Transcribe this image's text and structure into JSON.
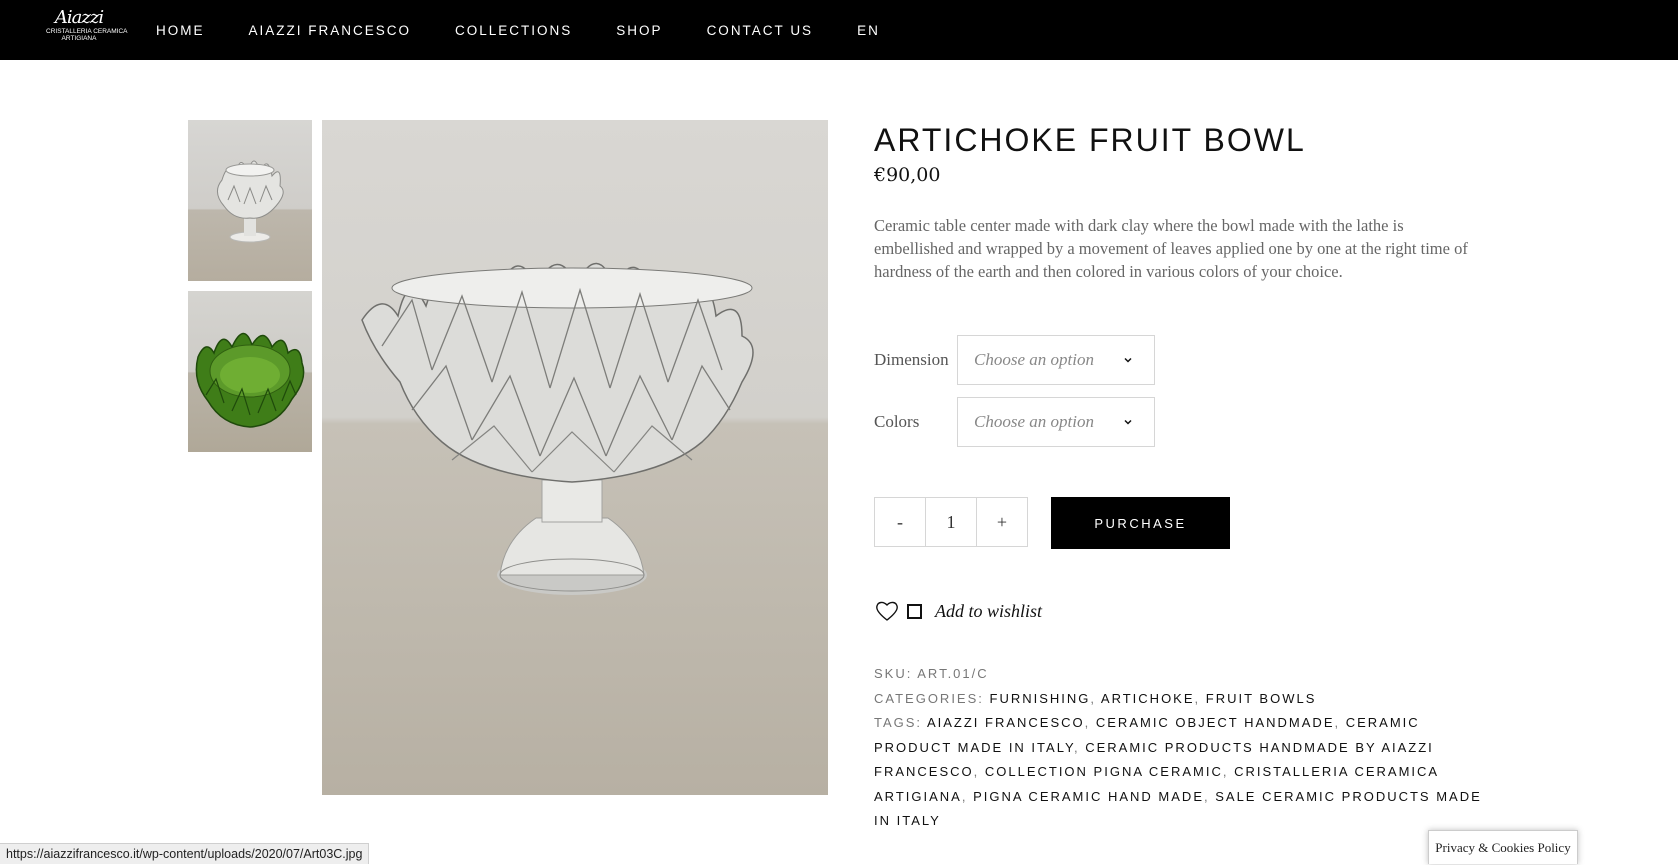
{
  "brand": {
    "logo_script": "Aiazzi",
    "logo_line1": "CRISTALLERIA CERAMICA",
    "logo_line2": "ARTIGIANA"
  },
  "nav": {
    "items": [
      "HOME",
      "AIAZZI FRANCESCO",
      "COLLECTIONS",
      "SHOP",
      "CONTACT US",
      "EN"
    ]
  },
  "product": {
    "title": "ARTICHOKE FRUIT BOWL",
    "price": "€90,00",
    "description": "Ceramic table center made with dark clay where the bowl made with the lathe is embellished and wrapped by a movement of leaves applied one by one at the right time of hardness of the earth and then colored in various colors of your choice.",
    "variations": [
      {
        "label": "Dimension",
        "placeholder": "Choose an option"
      },
      {
        "label": "Colors",
        "placeholder": "Choose an option"
      }
    ],
    "qty": {
      "minus": "-",
      "value": "1",
      "plus": "+"
    },
    "purchase_label": "PURCHASE",
    "wishlist_label": "Add to wishlist",
    "meta": {
      "sku_label": "SKU:",
      "sku": "ART.01/C",
      "categories_label": "CATEGORIES:",
      "categories": [
        "FURNISHING",
        "ARTICHOKE",
        "FRUIT BOWLS"
      ],
      "tags_label": "TAGS:",
      "tags": [
        "AIAZZI FRANCESCO",
        "CERAMIC OBJECT HANDMADE",
        "CERAMIC PRODUCT MADE IN ITALY",
        "CERAMIC PRODUCTS HANDMADE BY AIAZZI FRANCESCO",
        "COLLECTION PIGNA CERAMIC",
        "CRISTALLERIA CERAMICA ARTIGIANA",
        "PIGNA CERAMIC HAND MADE",
        "SALE CERAMIC PRODUCTS MADE IN ITALY"
      ]
    }
  },
  "gallery": {
    "thumbnails": [
      "white-artichoke-bowl",
      "green-artichoke-bowl"
    ],
    "main": "white-artichoke-bowl"
  },
  "statusbar": {
    "url": "https://aiazzifrancesco.it/wp-content/uploads/2020/07/Art03C.jpg"
  },
  "privacy": {
    "label": "Privacy & Cookies Policy"
  },
  "colors": {
    "nav_bg": "#000000",
    "button_bg": "#000000",
    "bowl_green": "#4f8a1f",
    "bowl_white": "#e8e8e6"
  }
}
